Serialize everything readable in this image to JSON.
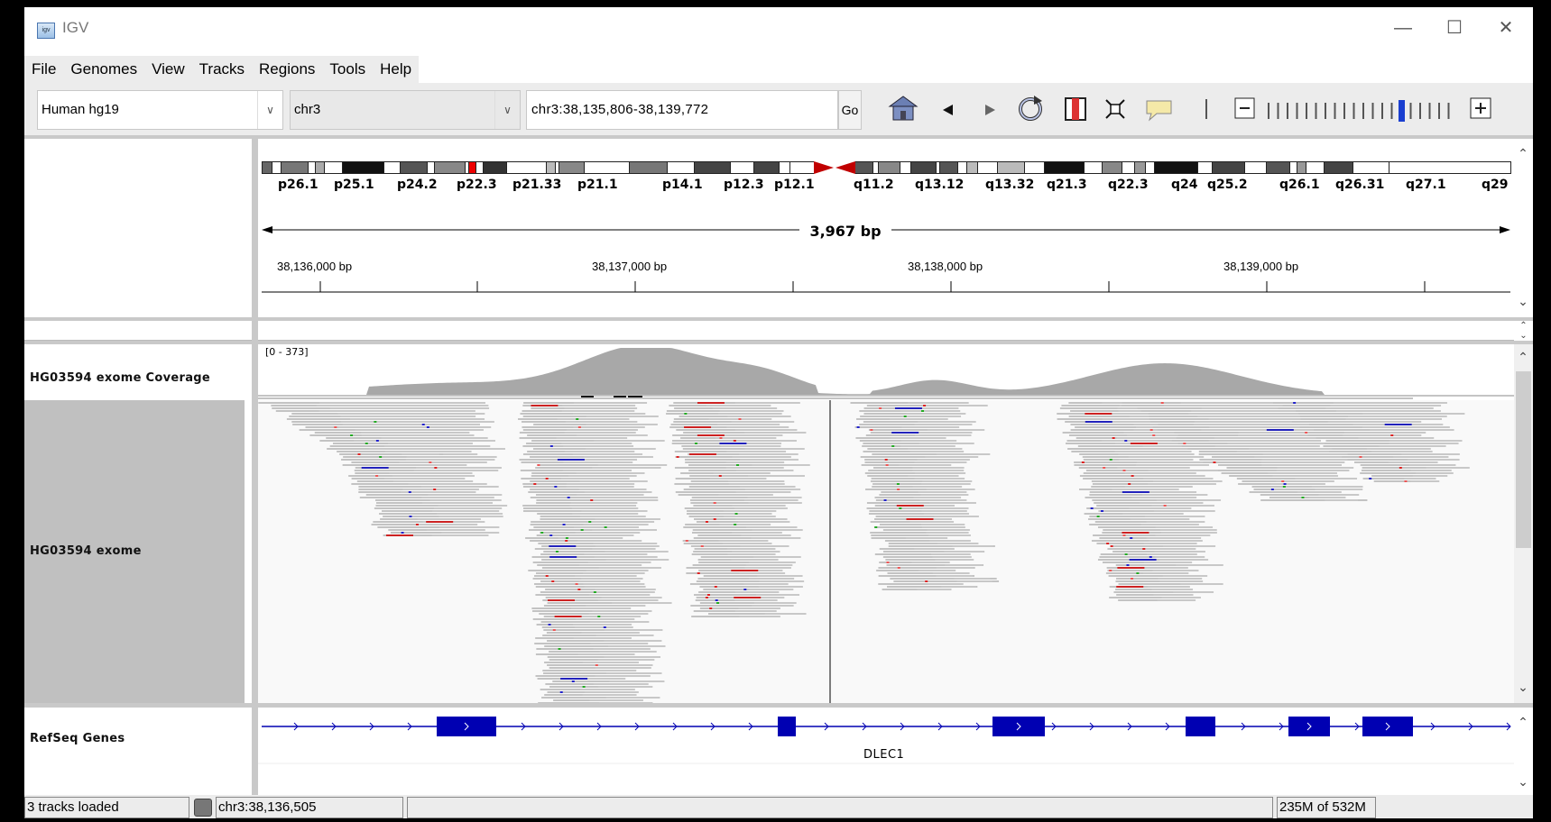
{
  "window": {
    "title": "IGV",
    "minimize": "—",
    "maximize": "☐",
    "close": "✕"
  },
  "menu": [
    "File",
    "Genomes",
    "View",
    "Tracks",
    "Regions",
    "Tools",
    "Help"
  ],
  "toolbar": {
    "genome": "Human hg19",
    "chromosome": "chr3",
    "locus": "chr3:38,135,806-38,139,772",
    "go_label": "Go",
    "zoom_ticks": 20,
    "zoom_level": 14
  },
  "ideogram": {
    "bands": [
      "p26.1",
      "p25.1",
      "p24.2",
      "p22.3",
      "p21.33",
      "p21.1",
      "p14.1",
      "p12.3",
      "p12.1",
      "q11.2",
      "q13.12",
      "q13.32",
      "q21.3",
      "q22.3",
      "q24",
      "q25.2",
      "q26.1",
      "q26.31",
      "q27.1",
      "q29"
    ]
  },
  "ruler": {
    "span": "3,967 bp",
    "ticks": [
      "38,136,000 bp",
      "38,137,000 bp",
      "38,138,000 bp",
      "38,139,000 bp"
    ]
  },
  "tracks": {
    "coverage_name": "HG03594 exome Coverage",
    "coverage_range": "[0 - 373]",
    "alignment_name": "HG03594 exome",
    "genes_name": "RefSeq Genes",
    "gene_label": "DLEC1"
  },
  "status": {
    "message": "3 tracks loaded",
    "position": "chr3:38,136,505",
    "memory": "235M of 532M"
  },
  "colors": {
    "gene_blue": "#0000b2",
    "read_gray": "#c3c3c3",
    "name_panel_gray": "#c0c0c0"
  }
}
